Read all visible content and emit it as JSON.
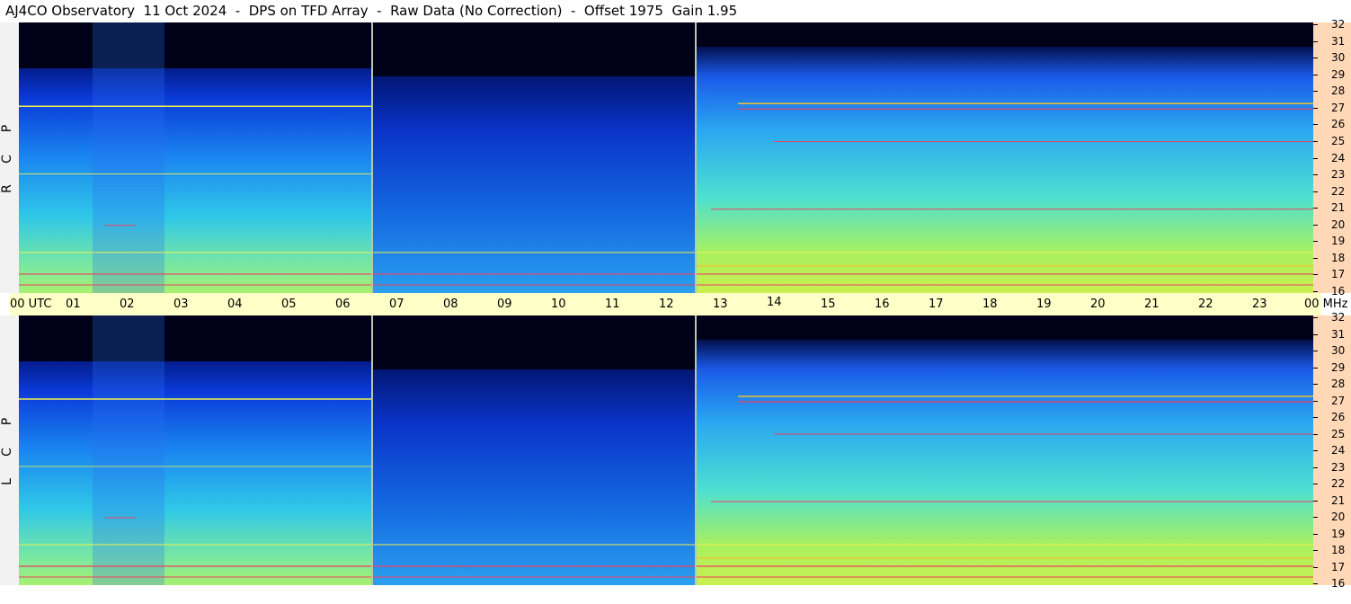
{
  "header": {
    "title": "AJ4CO Observatory  11 Oct 2024  -  DPS on TFD Array  -  Raw Data (No Correction)  -  Offset 1975  Gain 1.95"
  },
  "chart_data": [
    {
      "type": "heatmap",
      "panel": "top",
      "polarization_label": [
        "R",
        "C",
        "P"
      ],
      "x_range_utc_hours": [
        0,
        24
      ],
      "y_range_mhz": [
        16,
        32
      ],
      "colormap": [
        "#00003a",
        "#0a2ad8",
        "#1a7bf0",
        "#33c6f0",
        "#6ef0b0",
        "#c8f050",
        "#f0c030",
        "#f04060"
      ]
    },
    {
      "type": "heatmap",
      "panel": "bottom",
      "polarization_label": [
        "L",
        "C",
        "P"
      ],
      "x_range_utc_hours": [
        0,
        24
      ],
      "y_range_mhz": [
        16,
        32
      ],
      "colormap": [
        "#00003a",
        "#0a2ad8",
        "#1a7bf0",
        "#33c6f0",
        "#6ef0b0",
        "#c8f050",
        "#f0c030",
        "#f04060"
      ]
    }
  ],
  "axes": {
    "utc_labels": [
      "00 UTC",
      "01",
      "02",
      "03",
      "04",
      "05",
      "06",
      "07",
      "08",
      "09",
      "10",
      "11",
      "12",
      "13",
      "14",
      "15",
      "16",
      "17",
      "18",
      "19",
      "20",
      "21",
      "22",
      "23",
      "00 MHz"
    ],
    "mhz_labels": [
      "32",
      "31",
      "30",
      "29",
      "28",
      "27",
      "26",
      "25",
      "24",
      "23",
      "22",
      "21",
      "20",
      "19",
      "18",
      "17",
      "16"
    ]
  },
  "colors": {
    "utc_axis_bg": "#ffffc8",
    "mhz_axis_bg": "#ffd8b8",
    "background": "#ffffff"
  }
}
